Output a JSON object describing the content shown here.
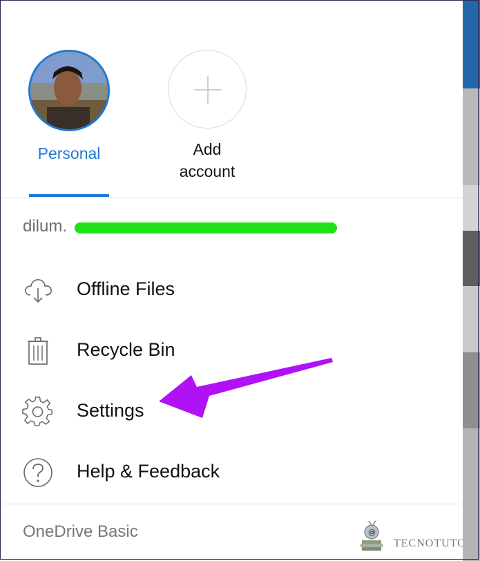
{
  "accounts": [
    {
      "label": "Personal",
      "active": true
    },
    {
      "label_line1": "Add",
      "label_line2": "account"
    }
  ],
  "user": {
    "email_visible": "dilum."
  },
  "menu": {
    "items": [
      {
        "icon": "cloud-download-icon",
        "label": "Offline Files"
      },
      {
        "icon": "trash-icon",
        "label": "Recycle Bin"
      },
      {
        "icon": "gear-icon",
        "label": "Settings"
      },
      {
        "icon": "help-circle-icon",
        "label": "Help & Feedback"
      }
    ]
  },
  "footer": {
    "plan": "OneDrive Basic"
  },
  "watermark": {
    "text": "TECNOTUTO"
  },
  "colors": {
    "accent": "#1f7ad1",
    "annotation_arrow": "#b011f5",
    "redaction": "#22e01a"
  }
}
